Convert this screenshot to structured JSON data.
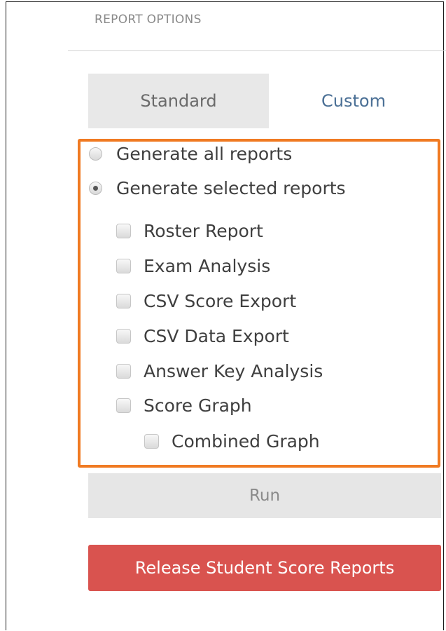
{
  "report_options": {
    "title": "REPORT OPTIONS",
    "tabs": [
      {
        "label": "Standard",
        "selected": true
      },
      {
        "label": "Custom",
        "selected": false
      }
    ],
    "generate_options": [
      {
        "label": "Generate all reports",
        "checked": false
      },
      {
        "label": "Generate selected reports",
        "checked": true
      }
    ],
    "reports": [
      {
        "label": "Roster Report",
        "checked": false
      },
      {
        "label": "Exam Analysis",
        "checked": false
      },
      {
        "label": "CSV Score Export",
        "checked": false
      },
      {
        "label": "CSV Data Export",
        "checked": false
      },
      {
        "label": "Answer Key Analysis",
        "checked": false
      },
      {
        "label": "Score Graph",
        "checked": false
      },
      {
        "label": "Combined Graph",
        "checked": false
      }
    ],
    "run_label": "Run",
    "release_label": "Release Student Score Reports"
  },
  "colors": {
    "highlight": "#f07a22",
    "release_button": "#d9534f",
    "custom_tab_text": "#4a6f95"
  }
}
